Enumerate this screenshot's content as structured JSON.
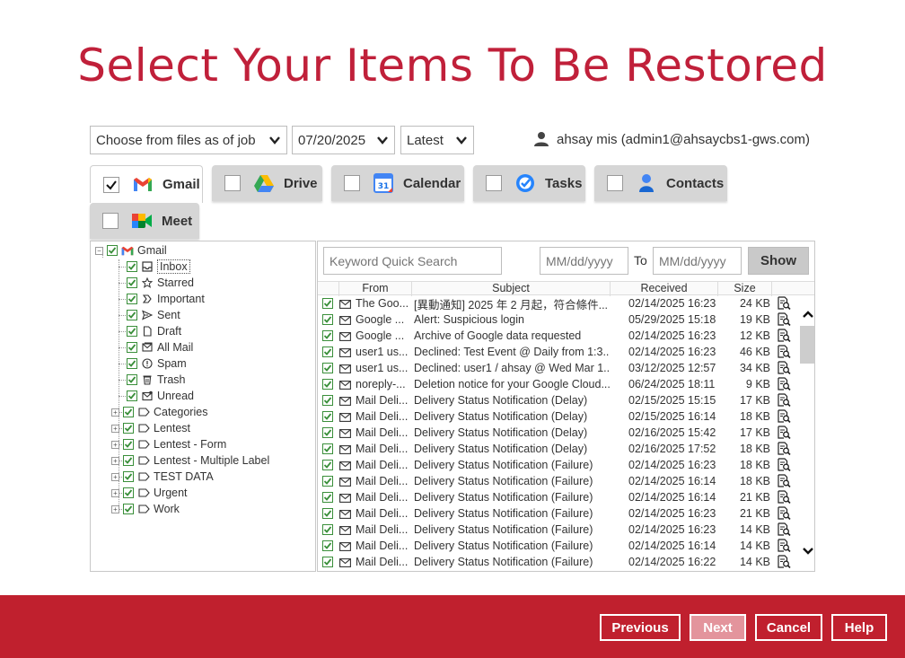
{
  "title": "Select Your Items To Be Restored",
  "filters": {
    "mode": "Choose from files as of job",
    "date": "07/20/2025",
    "version": "Latest"
  },
  "user": "ahsay mis (admin1@ahsaycbs1-gws.com)",
  "tabs": [
    {
      "label": "Gmail",
      "checked": true,
      "icon": "gmail-icon"
    },
    {
      "label": "Drive",
      "checked": false,
      "icon": "drive-icon"
    },
    {
      "label": "Calendar",
      "checked": false,
      "icon": "calendar-icon"
    },
    {
      "label": "Tasks",
      "checked": false,
      "icon": "tasks-icon"
    },
    {
      "label": "Contacts",
      "checked": false,
      "icon": "contacts-icon"
    },
    {
      "label": "Meet",
      "checked": false,
      "icon": "meet-icon"
    }
  ],
  "calendar_day": "31",
  "tree": {
    "root": "Gmail",
    "items": [
      {
        "label": "Inbox",
        "icon": "inbox-icon",
        "expandable": false
      },
      {
        "label": "Starred",
        "icon": "star-icon",
        "expandable": false
      },
      {
        "label": "Important",
        "icon": "important-icon",
        "expandable": false
      },
      {
        "label": "Sent",
        "icon": "sent-icon",
        "expandable": false
      },
      {
        "label": "Draft",
        "icon": "draft-icon",
        "expandable": false
      },
      {
        "label": "All Mail",
        "icon": "all-mail-icon",
        "expandable": false
      },
      {
        "label": "Spam",
        "icon": "spam-icon",
        "expandable": false
      },
      {
        "label": "Trash",
        "icon": "trash-icon",
        "expandable": false
      },
      {
        "label": "Unread",
        "icon": "unread-icon",
        "expandable": false
      },
      {
        "label": "Categories",
        "icon": "label-icon",
        "expandable": true
      },
      {
        "label": "Lentest",
        "icon": "label-icon",
        "expandable": true
      },
      {
        "label": "Lentest - Form",
        "icon": "label-icon",
        "expandable": true
      },
      {
        "label": "Lentest - Multiple Label",
        "icon": "label-icon",
        "expandable": true
      },
      {
        "label": "TEST DATA",
        "icon": "label-icon",
        "expandable": true
      },
      {
        "label": "Urgent",
        "icon": "label-icon",
        "expandable": true
      },
      {
        "label": "Work",
        "icon": "label-icon",
        "expandable": true
      }
    ],
    "expand_symbol": "+",
    "collapse_symbol": "−"
  },
  "search": {
    "placeholder": "Keyword Quick Search",
    "from_placeholder": "MM/dd/yyyy",
    "to_label": "To",
    "to_placeholder": "MM/dd/yyyy",
    "show_label": "Show"
  },
  "columns": {
    "from": "From",
    "subject": "Subject",
    "received": "Received",
    "size": "Size"
  },
  "mails": [
    {
      "from": "The Goo...",
      "subject": "[異動通知] 2025 年 2 月起，符合條件...",
      "received": "02/14/2025 16:23",
      "size": "24 KB"
    },
    {
      "from": "Google ...",
      "subject": "Alert:  Suspicious login",
      "received": "05/29/2025 15:18",
      "size": "19 KB"
    },
    {
      "from": "Google ...",
      "subject": "Archive of Google data requested",
      "received": "02/14/2025 16:23",
      "size": "12 KB"
    },
    {
      "from": "user1 us...",
      "subject": "Declined: Test Event @ Daily from 1:3...",
      "received": "02/14/2025 16:23",
      "size": "46 KB"
    },
    {
      "from": "user1 us...",
      "subject": "Declined: user1 / ahsay @ Wed Mar 1...",
      "received": "03/12/2025 12:57",
      "size": "34 KB"
    },
    {
      "from": "noreply-...",
      "subject": "Deletion notice for your Google Cloud...",
      "received": "06/24/2025 18:11",
      "size": "9 KB"
    },
    {
      "from": "Mail Deli...",
      "subject": "Delivery Status Notification (Delay)",
      "received": "02/15/2025 15:15",
      "size": "17 KB"
    },
    {
      "from": "Mail Deli...",
      "subject": "Delivery Status Notification (Delay)",
      "received": "02/15/2025 16:14",
      "size": "18 KB"
    },
    {
      "from": "Mail Deli...",
      "subject": "Delivery Status Notification (Delay)",
      "received": "02/16/2025 15:42",
      "size": "17 KB"
    },
    {
      "from": "Mail Deli...",
      "subject": "Delivery Status Notification (Delay)",
      "received": "02/16/2025 17:52",
      "size": "18 KB"
    },
    {
      "from": "Mail Deli...",
      "subject": "Delivery Status Notification (Failure)",
      "received": "02/14/2025 16:23",
      "size": "18 KB"
    },
    {
      "from": "Mail Deli...",
      "subject": "Delivery Status Notification (Failure)",
      "received": "02/14/2025 16:14",
      "size": "18 KB"
    },
    {
      "from": "Mail Deli...",
      "subject": "Delivery Status Notification (Failure)",
      "received": "02/14/2025 16:14",
      "size": "21 KB"
    },
    {
      "from": "Mail Deli...",
      "subject": "Delivery Status Notification (Failure)",
      "received": "02/14/2025 16:23",
      "size": "21 KB"
    },
    {
      "from": "Mail Deli...",
      "subject": "Delivery Status Notification (Failure)",
      "received": "02/14/2025 16:23",
      "size": "14 KB"
    },
    {
      "from": "Mail Deli...",
      "subject": "Delivery Status Notification (Failure)",
      "received": "02/14/2025 16:14",
      "size": "14 KB"
    },
    {
      "from": "Mail Deli...",
      "subject": "Delivery Status Notification (Failure)",
      "received": "02/14/2025 16:22",
      "size": "14 KB"
    }
  ],
  "buttons": {
    "previous": "Previous",
    "next": "Next",
    "cancel": "Cancel",
    "help": "Help"
  },
  "colors": {
    "brand": "#c0202e",
    "title": "#c0203a",
    "check": "#3a8f3a"
  }
}
